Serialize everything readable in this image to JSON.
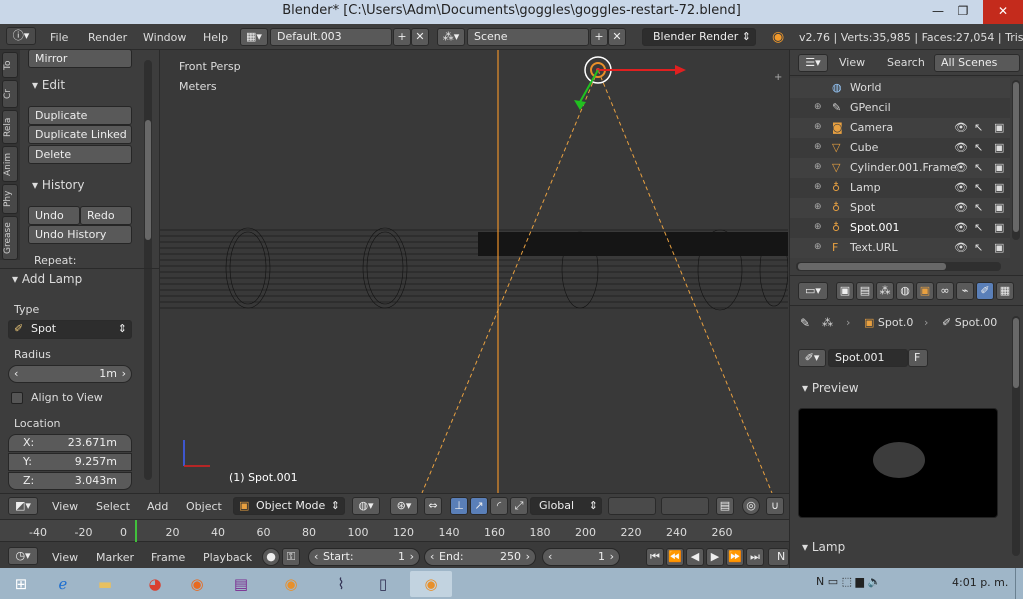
{
  "window": {
    "title": "Blender* [C:\\Users\\Adm\\Documents\\goggles\\goggles-restart-72.blend]"
  },
  "menubar": {
    "items": [
      "File",
      "Render",
      "Window",
      "Help"
    ],
    "layout": "Default.003",
    "scene": "Scene",
    "engine": "Blender Render",
    "stats": "v2.76 | Verts:35,985 | Faces:27,054 | Tris:4"
  },
  "toolshelf": {
    "tabs": [
      "To",
      "Cr",
      "Rela",
      "Anim",
      "Phy",
      "Grease"
    ],
    "mirror": "Mirror",
    "edit_title": "Edit",
    "duplicate": "Duplicate",
    "duplicate_linked": "Duplicate Linked",
    "delete": "Delete",
    "history_title": "History",
    "undo": "Undo",
    "redo": "Redo",
    "undo_history": "Undo History",
    "repeat": "Repeat:",
    "add_lamp_title": "Add Lamp",
    "type_label": "Type",
    "type_value": "Spot",
    "radius_label": "Radius",
    "radius_value": "1m",
    "align_label": "Align to View",
    "location_label": "Location",
    "x_label": "X:",
    "x_value": "23.671m",
    "y_label": "Y:",
    "y_value": "9.257m",
    "z_label": "Z:",
    "z_value": "3.043m"
  },
  "viewport": {
    "view_name": "Front Persp",
    "units": "Meters",
    "object_label": "(1) Spot.001"
  },
  "view_header": {
    "items": [
      "View",
      "Select",
      "Add",
      "Object"
    ],
    "mode": "Object Mode",
    "orientation": "Global"
  },
  "outliner": {
    "view": "View",
    "search": "Search",
    "filter": "All Scenes",
    "rows": [
      "World",
      "GPencil",
      "Camera",
      "Cube",
      "Cylinder.001.Frame",
      "Lamp",
      "Spot",
      "Spot.001",
      "Text.URL"
    ]
  },
  "properties": {
    "crumb1": "Spot.0",
    "crumb2": "Spot.00",
    "datablock": "Spot.001",
    "fake_user": "F",
    "preview_title": "Preview",
    "lamp_title": "Lamp"
  },
  "timeline": {
    "ticks": [
      "-40",
      "-20",
      "0",
      "20",
      "40",
      "60",
      "80",
      "100",
      "120",
      "140",
      "160",
      "180",
      "200",
      "220",
      "240",
      "260"
    ],
    "items": [
      "View",
      "Marker",
      "Frame",
      "Playback"
    ],
    "start_label": "Start:",
    "start_value": "1",
    "end_label": "End:",
    "end_value": "250",
    "current": "1",
    "more": "N"
  },
  "taskbar": {
    "clock": "4:01 p. m."
  }
}
